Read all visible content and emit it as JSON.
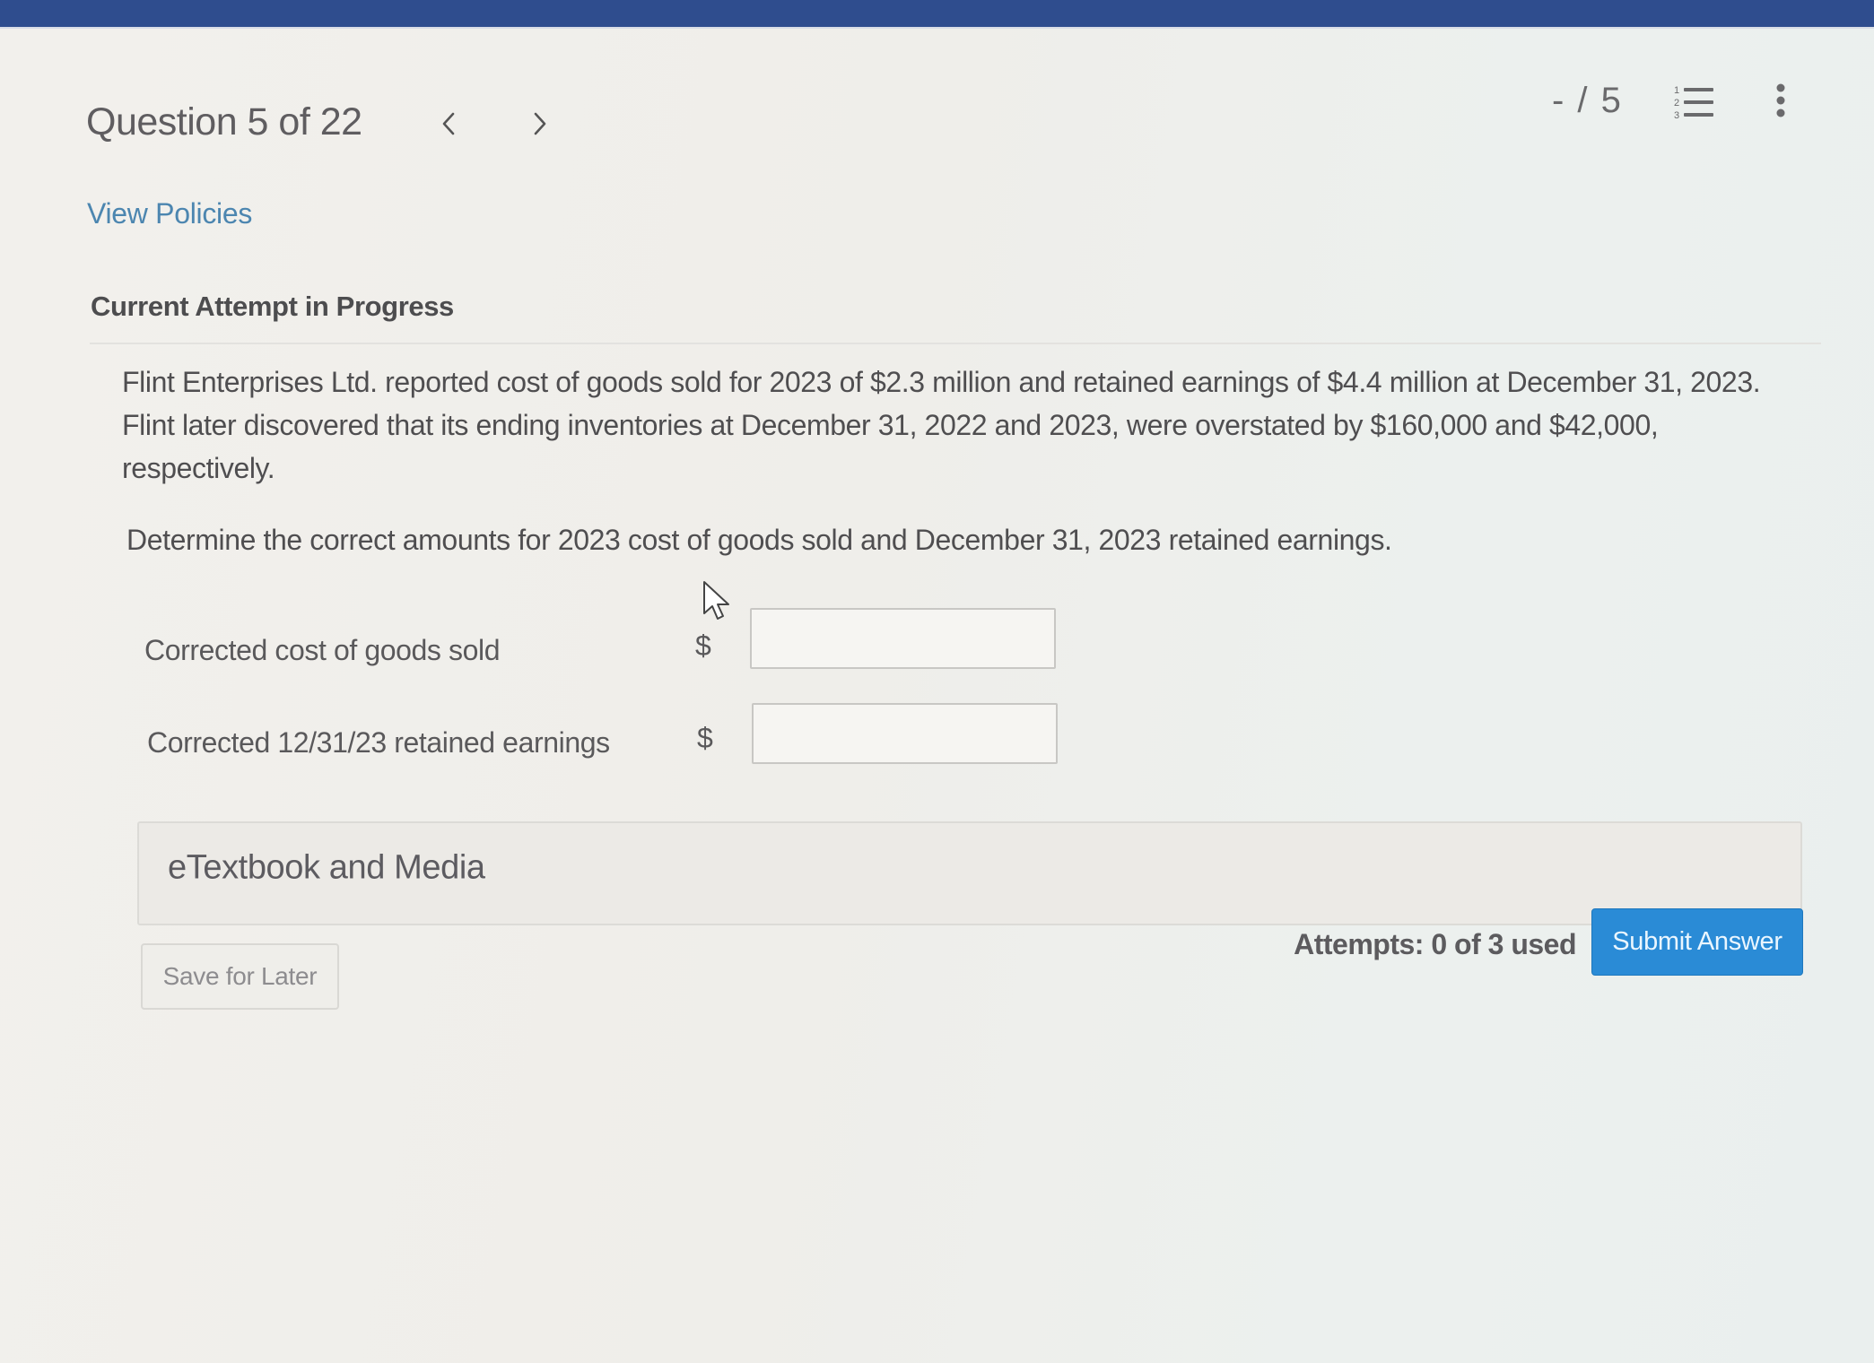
{
  "header": {
    "question_label": "Question 5 of 22",
    "prev_icon": "chevron-left-icon",
    "next_icon": "chevron-right-icon",
    "score": "- / 5",
    "question_list_icon": "numbered-list-icon",
    "more_icon": "kebab-menu-icon"
  },
  "links": {
    "view_policies": "View Policies"
  },
  "attempt": {
    "heading": "Current Attempt in Progress"
  },
  "question": {
    "problem_text": "Flint Enterprises Ltd. reported cost of goods sold for 2023 of $2.3 million and retained earnings of $4.4 million at December 31, 2023. Flint later discovered that its ending inventories at December 31, 2022 and 2023, were overstated by $160,000 and $42,000, respectively.",
    "instruction": "Determine the correct amounts for 2023 cost of goods sold and December 31, 2023 retained earnings."
  },
  "answers": [
    {
      "label": "Corrected cost of goods sold",
      "currency": "$",
      "value": ""
    },
    {
      "label": "Corrected 12/31/23 retained earnings",
      "currency": "$",
      "value": ""
    }
  ],
  "resources": {
    "etextbook_label": "eTextbook and Media"
  },
  "footer": {
    "save_label": "Save for Later",
    "attempts_text": "Attempts: 0 of 3 used",
    "submit_label": "Submit Answer"
  },
  "colors": {
    "top_bar": "#2f4d8e",
    "link": "#4c86b0",
    "submit": "#2a8bd6"
  }
}
